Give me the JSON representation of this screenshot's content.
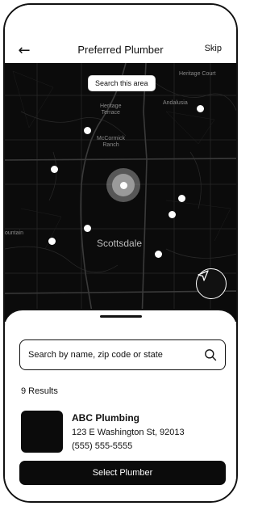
{
  "header": {
    "back_icon": "arrow-left-icon",
    "title": "Preferred Plumber",
    "skip_label": "Skip"
  },
  "map": {
    "search_area_label": "Search this area",
    "labels": {
      "heritage_court": "Heritage Court",
      "andalusia": "Andalusia",
      "heritage_terrace_1": "Heritage",
      "heritage_terrace_2": "Terrace",
      "mccormick_1": "McCormick",
      "mccormick_2": "Ranch",
      "mountain": "ountain",
      "scottsdale": "Scottsdale"
    },
    "locate_icon": "navigation-arrow-icon"
  },
  "sheet": {
    "search_placeholder": "Search by name, zip code or state",
    "search_icon": "search-icon",
    "results_label": "9 Results",
    "card": {
      "name": "ABC Plumbing",
      "address": "123 E Washington St, 92013",
      "phone": "(555) 555-5555"
    },
    "select_label": "Select Plumber"
  },
  "colors": {
    "map_bg": "#0b0b0b",
    "accent": "#111111",
    "pin": "#ffffff"
  }
}
